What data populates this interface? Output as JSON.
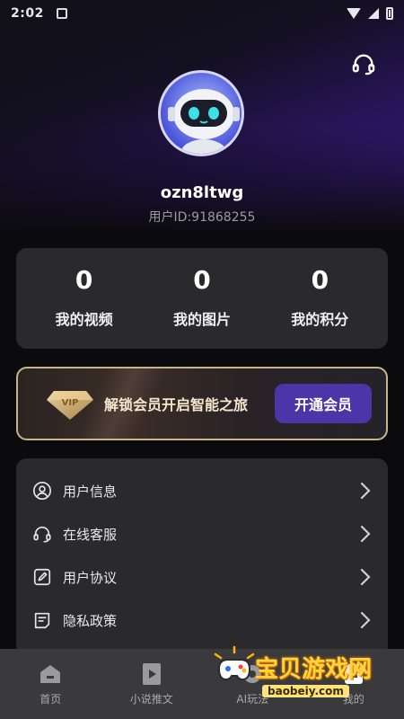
{
  "status_bar": {
    "time": "2:02",
    "icons": [
      "notification-icon",
      "wifi-icon",
      "signal-icon",
      "battery-icon"
    ]
  },
  "header": {
    "support_icon": "headset-icon"
  },
  "profile": {
    "username": "ozn8ltwg",
    "user_id": "用户ID:91868255",
    "avatar": "robot-avatar"
  },
  "stats": [
    {
      "value": "0",
      "label": "我的视频"
    },
    {
      "value": "0",
      "label": "我的图片"
    },
    {
      "value": "0",
      "label": "我的积分"
    }
  ],
  "vip": {
    "badge_text": "VIP",
    "text": "解锁会员开启智能之旅",
    "button": "开通会员",
    "accent": "#c9b48a",
    "button_color": "#4a36a8"
  },
  "menu": [
    {
      "label": "用户信息",
      "icon": "user-circle-icon"
    },
    {
      "label": "在线客服",
      "icon": "headset-icon"
    },
    {
      "label": "用户协议",
      "icon": "edit-document-icon"
    },
    {
      "label": "隐私政策",
      "icon": "policy-document-icon"
    }
  ],
  "bottom_nav": [
    {
      "label": "首页",
      "icon": "home-icon"
    },
    {
      "label": "小说推文",
      "icon": "video-icon"
    },
    {
      "label": "AI玩法",
      "icon": "ai-icon"
    },
    {
      "label": "我的",
      "icon": "profile-icon"
    }
  ],
  "watermark": {
    "text": "宝贝游戏网",
    "url": "baobeiy.com"
  }
}
